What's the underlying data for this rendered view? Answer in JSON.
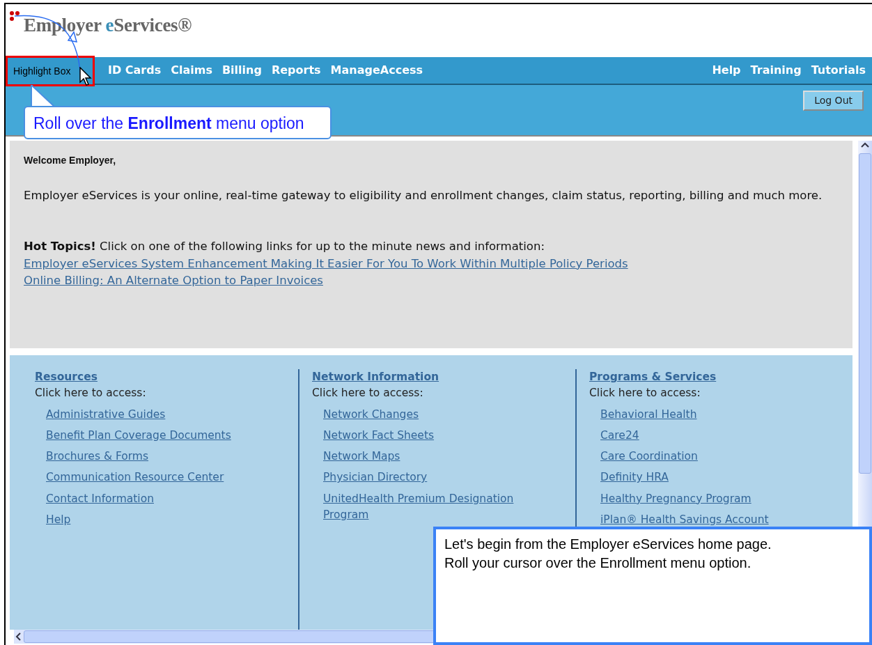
{
  "header": {
    "logo_main": "Employer ",
    "logo_accent": "e",
    "logo_rest": "Services®"
  },
  "nav_left": [
    "ID Cards",
    "Claims",
    "Billing",
    "Reports",
    "ManageAccess"
  ],
  "nav_right": [
    "Help",
    "Training",
    "Tutorials"
  ],
  "logout_button": "Log Out",
  "welcome": {
    "title": "Welcome Employer,",
    "intro": "Employer eServices is your online, real-time gateway to eligibility and enrollment changes, claim status, reporting, billing and much more.",
    "hot_topics": "**Hot Topics!** Click on one of the following links for up to the minute news and information:",
    "links": [
      "Employer eServices System Enhancement Making It Easier For You To Work Within Multiple Policy Periods",
      "Online Billing: An Alternate Option to Paper Invoices"
    ]
  },
  "columns": [
    {
      "heading": "Resources",
      "subtitle": "Click here to access:",
      "links": [
        "Administrative Guides",
        "Benefit Plan Coverage Documents",
        "Brochures & Forms",
        "Communication Resource Center",
        "Contact Information",
        "Help"
      ]
    },
    {
      "heading": "Network Information",
      "subtitle": "Click here to access:",
      "links": [
        "Network Changes",
        "Network Fact Sheets",
        "Network Maps",
        "Physician Directory",
        "UnitedHealth Premium Designation Program"
      ]
    },
    {
      "heading": "Programs & Services",
      "subtitle": "Click here to access:",
      "links": [
        "Behavioral Health",
        "Care24",
        "Care Coordination",
        "Definity HRA",
        "Healthy Pregnancy Program",
        "iPlan® Health Savings Account"
      ]
    }
  ],
  "annotations": {
    "highlight_box": "Highlight Box",
    "callout": "Roll over the **Enrollment** menu option",
    "caption_lines": [
      "Let's begin from the Employer eServices home page.",
      "Roll your cursor over the Enrollment menu option."
    ]
  }
}
